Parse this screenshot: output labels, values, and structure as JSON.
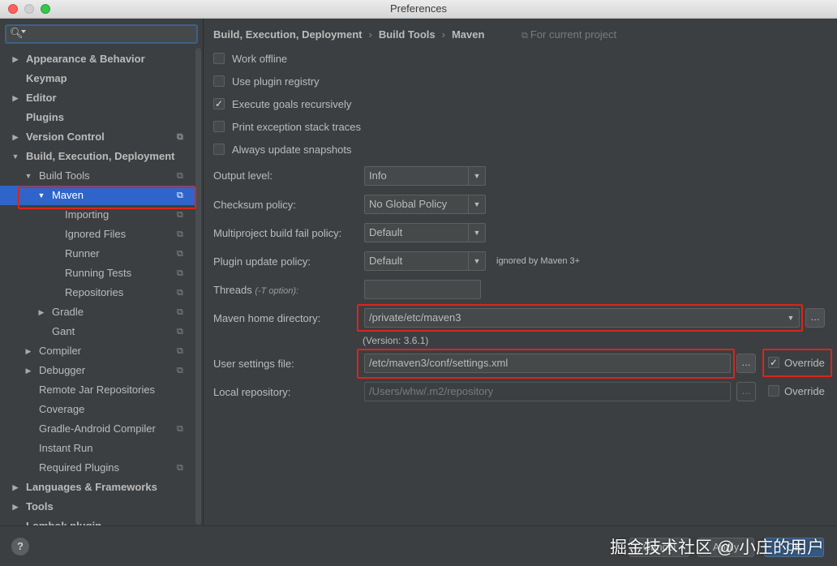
{
  "window": {
    "title": "Preferences"
  },
  "sidebar": {
    "search_placeholder": "",
    "items": [
      {
        "label": "Appearance & Behavior",
        "expander": "right"
      },
      {
        "label": "Keymap",
        "expander": ""
      },
      {
        "label": "Editor",
        "expander": "right"
      },
      {
        "label": "Plugins",
        "expander": ""
      },
      {
        "label": "Version Control",
        "expander": "right"
      },
      {
        "label": "Build, Execution, Deployment",
        "expander": "down"
      },
      {
        "label": "Build Tools",
        "expander": "down"
      },
      {
        "label": "Maven",
        "expander": "down"
      },
      {
        "label": "Importing",
        "expander": ""
      },
      {
        "label": "Ignored Files",
        "expander": ""
      },
      {
        "label": "Runner",
        "expander": ""
      },
      {
        "label": "Running Tests",
        "expander": ""
      },
      {
        "label": "Repositories",
        "expander": ""
      },
      {
        "label": "Gradle",
        "expander": "right"
      },
      {
        "label": "Gant",
        "expander": ""
      },
      {
        "label": "Compiler",
        "expander": "right"
      },
      {
        "label": "Debugger",
        "expander": "right"
      },
      {
        "label": "Remote Jar Repositories",
        "expander": ""
      },
      {
        "label": "Coverage",
        "expander": ""
      },
      {
        "label": "Gradle-Android Compiler",
        "expander": ""
      },
      {
        "label": "Instant Run",
        "expander": ""
      },
      {
        "label": "Required Plugins",
        "expander": ""
      },
      {
        "label": "Languages & Frameworks",
        "expander": "right"
      },
      {
        "label": "Tools",
        "expander": "right"
      },
      {
        "label": "Lombok plugin",
        "expander": ""
      }
    ],
    "selected": "Maven"
  },
  "main": {
    "breadcrumb": [
      "Build, Execution, Deployment",
      "Build Tools",
      "Maven"
    ],
    "breadcrumb_sep": "›",
    "scope_note": "For current project",
    "checkboxes": [
      {
        "label": "Work offline",
        "checked": false
      },
      {
        "label": "Use plugin registry",
        "checked": false
      },
      {
        "label": "Execute goals recursively",
        "checked": true
      },
      {
        "label": "Print exception stack traces",
        "checked": false
      },
      {
        "label": "Always update snapshots",
        "checked": false
      }
    ],
    "output_level": {
      "label": "Output level:",
      "value": "Info"
    },
    "checksum_policy": {
      "label": "Checksum policy:",
      "value": "No Global Policy"
    },
    "fail_policy": {
      "label": "Multiproject build fail policy:",
      "value": "Default"
    },
    "plugin_update": {
      "label": "Plugin update policy:",
      "value": "Default",
      "hint": "ignored by Maven 3+"
    },
    "threads": {
      "label": "Threads",
      "hint": "(-T option):",
      "value": ""
    },
    "maven_home": {
      "label": "Maven home directory:",
      "value": "/private/etc/maven3",
      "version": "(Version: 3.6.1)"
    },
    "user_settings": {
      "label": "User settings file:",
      "value": "/etc/maven3/conf/settings.xml",
      "override_label": "Override",
      "override_checked": true
    },
    "local_repo": {
      "label": "Local repository:",
      "value": "/Users/whw/.m2/repository",
      "override_label": "Override",
      "override_checked": false
    },
    "browse_label": "..."
  },
  "footer": {
    "help": "?",
    "cancel": "Cancel",
    "apply": "Apply",
    "ok": "OK"
  },
  "watermark": "掘金技术社区 @ 小庄的用户",
  "colors": {
    "selection": "#2f65ca",
    "highlight_box": "#d9261c",
    "background": "#3c3f41"
  }
}
